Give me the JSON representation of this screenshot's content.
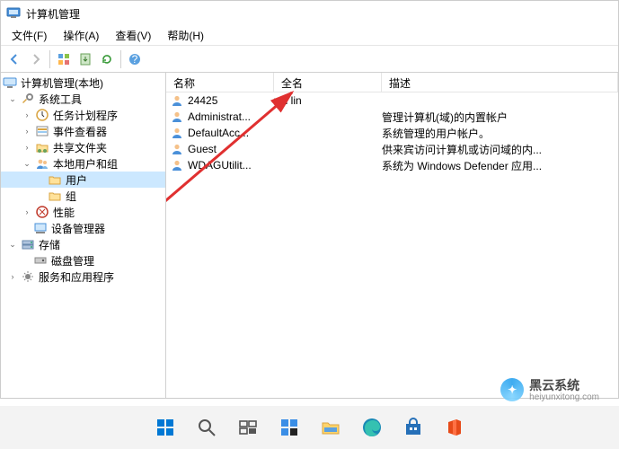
{
  "window": {
    "title": "计算机管理"
  },
  "menu": {
    "file": "文件(F)",
    "action": "操作(A)",
    "view": "查看(V)",
    "help": "帮助(H)"
  },
  "tree": {
    "root": "计算机管理(本地)",
    "system_tools": "系统工具",
    "task_scheduler": "任务计划程序",
    "event_viewer": "事件查看器",
    "shared_folders": "共享文件夹",
    "local_users_groups": "本地用户和组",
    "users": "用户",
    "groups": "组",
    "performance": "性能",
    "device_manager": "设备管理器",
    "storage": "存储",
    "disk_management": "磁盘管理",
    "services_apps": "服务和应用程序"
  },
  "columns": {
    "name": "名称",
    "fullname": "全名",
    "description": "描述"
  },
  "rows": [
    {
      "name": "24425",
      "fullname": "xin lin",
      "desc": ""
    },
    {
      "name": "Administrat...",
      "fullname": "",
      "desc": "管理计算机(域)的内置帐户"
    },
    {
      "name": "DefaultAcc...",
      "fullname": "",
      "desc": "系统管理的用户帐户。"
    },
    {
      "name": "Guest",
      "fullname": "",
      "desc": "供来宾访问计算机或访问域的内..."
    },
    {
      "name": "WDAGUtilit...",
      "fullname": "",
      "desc": "系统为 Windows Defender 应用..."
    }
  ],
  "watermark": {
    "brand": "黑云系统",
    "url": "heiyunxitong.com"
  }
}
